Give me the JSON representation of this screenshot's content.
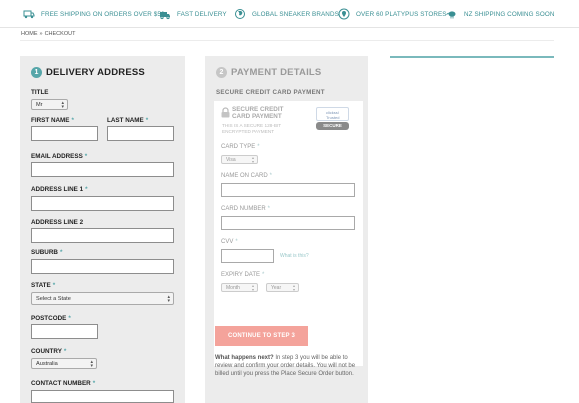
{
  "promo": [
    {
      "icon": "truck-icon",
      "text": "FREE SHIPPING ON ORDERS OVER $50"
    },
    {
      "icon": "delivery-van-icon",
      "text": "FAST DELIVERY"
    },
    {
      "icon": "globe-icon",
      "text": "GLOBAL SNEAKER BRANDS"
    },
    {
      "icon": "location-pin-icon",
      "text": "OVER 60 PLATYPUS STORES"
    },
    {
      "icon": "kiwi-bird-icon",
      "text": "NZ SHIPPING COMING SOON"
    }
  ],
  "breadcrumb": {
    "home": "HOME",
    "sep": "»",
    "current": "CHECKOUT"
  },
  "delivery": {
    "step": "1",
    "heading": "DELIVERY ADDRESS",
    "req": "*",
    "title_label": "TITLE",
    "title_value": "Mr",
    "first_name_label": "FIRST NAME",
    "last_name_label": "LAST NAME",
    "email_label": "EMAIL ADDRESS",
    "address1_label": "ADDRESS LINE 1",
    "address2_label": "ADDRESS LINE 2",
    "suburb_label": "SUBURB",
    "state_label": "STATE",
    "state_value": "Select a State",
    "postcode_label": "POSTCODE",
    "country_label": "COUNTRY",
    "country_value": "Australia",
    "contact_label": "CONTACT NUMBER"
  },
  "payment": {
    "step": "2",
    "heading": "PAYMENT DETAILS",
    "subheading": "SECURE CREDIT CARD PAYMENT",
    "secure_title": "SECURE CREDIT CARD PAYMENT",
    "secure_note": "THIS IS A SECURE 128-BIT ENCRYPTED PAYMENT",
    "badge_top": "clickssl Trusted",
    "badge_bottom": "SECURE",
    "req": "*",
    "card_type_label": "CARD TYPE",
    "card_type_value": "Visa",
    "name_on_card_label": "NAME ON CARD",
    "card_number_label": "CARD NUMBER",
    "cvv_label": "CVV",
    "cvv_help": "What is this?",
    "expiry_label": "EXPIRY DATE",
    "month_value": "Month",
    "year_value": "Year",
    "continue_label": "CONTINUE TO STEP 3",
    "happens_title": "What happens next?",
    "happens_text": "In step 3 you will be able to review and confirm your order details. You will not be billed until you press the Place Secure Order button."
  },
  "colors": {
    "accent": "#56a6a9",
    "button": "#f4a39b",
    "panel": "#ececec"
  }
}
